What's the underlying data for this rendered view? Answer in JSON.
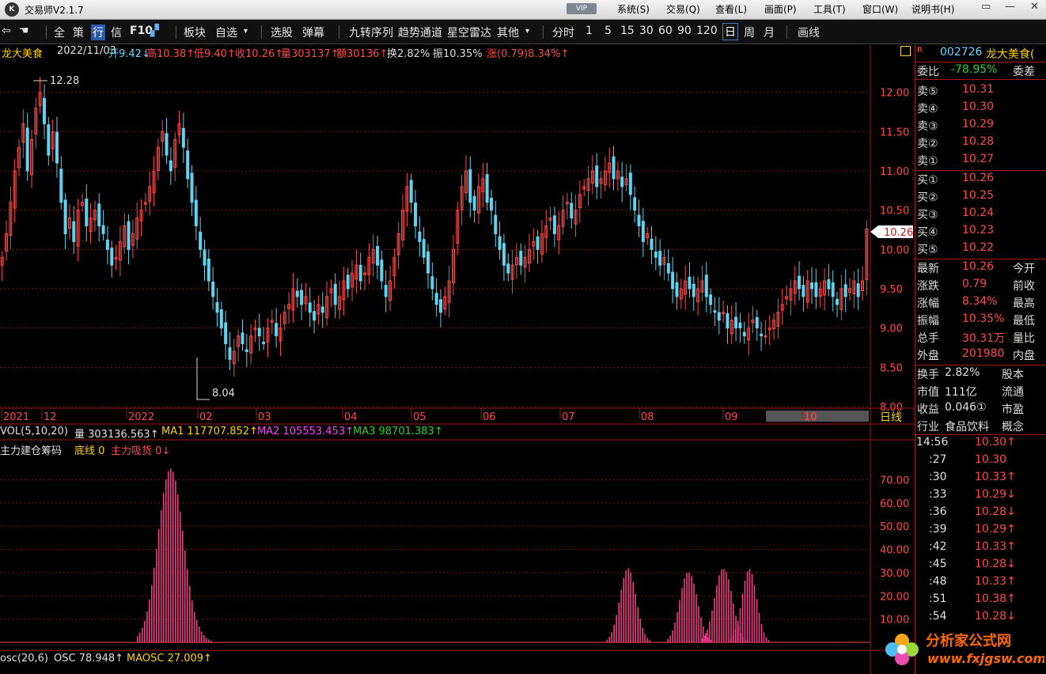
{
  "app": {
    "title": "交易师V2.1.7",
    "logo_text": "K",
    "vip": "VIP"
  },
  "menu": [
    "系统(S)",
    "交易(Q)",
    "查看(L)",
    "画面(P)",
    "工具(T)",
    "窗口(W)",
    "说明书(H)"
  ],
  "window_buttons": [
    "▭",
    "—",
    "✕"
  ],
  "toolbar": {
    "items": [
      "全",
      "策",
      "行",
      "信",
      "F10",
      "板块",
      "自选",
      "选股",
      "弹幕",
      "九转序列",
      "趋势通道",
      "星空雷达",
      "其他",
      "分时",
      "1",
      "5",
      "15",
      "30",
      "60",
      "90",
      "120",
      "日",
      "周",
      "月",
      "画线"
    ],
    "dropdown_arrow": "▾"
  },
  "info_bar": {
    "name": "龙大美食",
    "date": "2022/11/03",
    "open": "开9.42↓",
    "high": "高10.38↑",
    "low": "低9.40↑",
    "close": "收10.26↑",
    "volume": "量303137↑",
    "amount": "额30136↑",
    "turnover": "换2.82%",
    "amplitude": "振10.35%",
    "change": "涨(0.79)8.34%↑"
  },
  "chart_data": [
    {
      "type": "candlestick",
      "title": "龙大美食 日线",
      "price_ticks": [
        "12.00",
        "11.50",
        "11.00",
        "10.50",
        "10.00",
        "9.50",
        "9.00",
        "8.50",
        "8.00"
      ],
      "ylim": [
        8.0,
        12.5
      ],
      "annotations": [
        {
          "label": "12.28",
          "value": 12.28
        },
        {
          "label": "8.04",
          "value": 8.04
        }
      ],
      "last_price_label": "10.26",
      "x_labels": [
        "2021",
        "12",
        "2022",
        "02",
        "03",
        "04",
        "05",
        "06",
        "07",
        "08",
        "09",
        "10"
      ],
      "period_label": "日线",
      "closes": [
        9.9,
        10.2,
        10.6,
        11.0,
        11.3,
        11.6,
        11.0,
        11.4,
        11.8,
        12.0,
        11.6,
        11.2,
        11.5,
        11.1,
        10.6,
        10.2,
        10.4,
        10.1,
        10.5,
        10.6,
        10.3,
        10.4,
        10.5,
        10.3,
        10.2,
        10.0,
        9.8,
        9.9,
        10.1,
        10.3,
        10.0,
        10.2,
        10.4,
        10.5,
        10.6,
        10.8,
        11.0,
        11.3,
        11.5,
        11.2,
        11.0,
        11.4,
        11.6,
        11.3,
        10.9,
        10.6,
        10.3,
        10.0,
        9.8,
        9.6,
        9.4,
        9.2,
        9.0,
        8.8,
        8.6,
        8.7,
        8.9,
        8.8,
        8.7,
        8.9,
        9.0,
        8.9,
        8.8,
        9.0,
        9.1,
        8.9,
        9.0,
        9.2,
        9.3,
        9.5,
        9.4,
        9.3,
        9.4,
        9.2,
        9.1,
        9.3,
        9.2,
        9.4,
        9.5,
        9.3,
        9.4,
        9.6,
        9.5,
        9.7,
        9.8,
        9.6,
        9.7,
        9.9,
        10.0,
        9.8,
        9.6,
        9.4,
        9.6,
        9.9,
        10.2,
        10.5,
        10.8,
        10.6,
        10.3,
        10.1,
        9.9,
        9.7,
        9.5,
        9.3,
        9.2,
        9.4,
        9.6,
        10.0,
        10.5,
        10.8,
        11.0,
        10.6,
        10.5,
        10.8,
        10.9,
        10.6,
        10.5,
        10.2,
        10.0,
        9.8,
        9.7,
        9.8,
        9.9,
        9.8,
        9.9,
        10.0,
        10.1,
        10.0,
        10.2,
        10.3,
        10.4,
        10.2,
        10.3,
        10.5,
        10.6,
        10.4,
        10.5,
        10.7,
        10.8,
        10.9,
        11.0,
        10.8,
        10.9,
        11.0,
        11.1,
        10.9,
        11.0,
        10.8,
        10.9,
        10.7,
        10.5,
        10.3,
        10.1,
        10.2,
        10.0,
        9.9,
        9.8,
        9.9,
        9.7,
        9.5,
        9.4,
        9.5,
        9.6,
        9.5,
        9.4,
        9.5,
        9.6,
        9.4,
        9.3,
        9.2,
        9.1,
        9.2,
        9.0,
        9.1,
        9.0,
        9.0,
        8.9,
        9.0,
        9.1,
        9.0,
        8.9,
        8.9,
        9.0,
        9.1,
        9.2,
        9.3,
        9.4,
        9.5,
        9.6,
        9.5,
        9.4,
        9.6,
        9.5,
        9.4,
        9.5,
        9.6,
        9.5,
        9.4,
        9.3,
        9.5,
        9.4,
        9.5,
        9.6,
        9.4,
        9.6,
        10.26
      ]
    },
    {
      "type": "bar",
      "title": "主力建仓筹码",
      "y_ticks": [
        "70.00",
        "60.00",
        "50.00",
        "40.00",
        "30.00",
        "20.00",
        "10.00"
      ],
      "ylim": [
        0,
        80
      ],
      "clusters": [
        {
          "center": 0.196,
          "peak": 75,
          "width": 0.032
        },
        {
          "center": 0.722,
          "peak": 32,
          "width": 0.02
        },
        {
          "center": 0.792,
          "peak": 35,
          "width": 0.02
        },
        {
          "center": 0.832,
          "peak": 37,
          "width": 0.02
        },
        {
          "center": 0.862,
          "peak": 32,
          "width": 0.018
        }
      ]
    }
  ],
  "vol_bar": {
    "label": "VOL(5,10,20)",
    "vol": "量 303136.563↑",
    "ma1": "MA1 117707.852↑",
    "ma2": "MA2 105553.453↑",
    "ma3": "MA3 98701.383↑"
  },
  "indicator_bar": {
    "name": "主力建仓筹码",
    "bottom": "底线 0",
    "main": "主力吸货 0↓"
  },
  "osc_bar": {
    "label": "osc(20,6)",
    "osc": "OSC 78.948↑",
    "maosc": "MAOSC 27.009↑"
  },
  "panel": {
    "r_mark": "R",
    "code": "002726",
    "name": "龙大美食(",
    "ratio_label": "委比",
    "ratio": "-78.95%",
    "diff_label": "委差",
    "sell": [
      {
        "label": "卖⑤",
        "price": "10.31"
      },
      {
        "label": "卖④",
        "price": "10.30"
      },
      {
        "label": "卖③",
        "price": "10.29"
      },
      {
        "label": "卖②",
        "price": "10.28"
      },
      {
        "label": "卖①",
        "price": "10.27"
      }
    ],
    "buy": [
      {
        "label": "买①",
        "price": "10.26"
      },
      {
        "label": "买②",
        "price": "10.25"
      },
      {
        "label": "买③",
        "price": "10.24"
      },
      {
        "label": "买④",
        "price": "10.23"
      },
      {
        "label": "买⑤",
        "price": "10.22"
      }
    ],
    "quote": [
      {
        "l": "最新",
        "v": "10.26",
        "r": "今开"
      },
      {
        "l": "涨跌",
        "v": "0.79",
        "r": "前收"
      },
      {
        "l": "涨幅",
        "v": "8.34%",
        "r": "最高"
      },
      {
        "l": "振幅",
        "v": "10.35%",
        "r": "最低"
      },
      {
        "l": "总手",
        "v": "30.31万",
        "r": "量比"
      },
      {
        "l": "外盘",
        "v": "201980",
        "r": "内盘"
      }
    ],
    "stats": [
      {
        "l": "换手",
        "v": "2.82%",
        "r": "股本"
      },
      {
        "l": "市值",
        "v": "111亿",
        "r": "流通"
      },
      {
        "l": "收益",
        "v": "0.046①",
        "r": "市盈"
      },
      {
        "l": "行业",
        "v": "食品饮料",
        "r": "概念"
      }
    ],
    "ticks": [
      {
        "t": "14:56",
        "p": "10.30↑"
      },
      {
        "t": ":27",
        "p": "10.30"
      },
      {
        "t": ":30",
        "p": "10.33↑"
      },
      {
        "t": ":33",
        "p": "10.29↓"
      },
      {
        "t": ":36",
        "p": "10.28↓"
      },
      {
        "t": ":39",
        "p": "10.29↑"
      },
      {
        "t": ":42",
        "p": "10.33↑"
      },
      {
        "t": ":45",
        "p": "10.28↓"
      },
      {
        "t": ":48",
        "p": "10.33↑"
      },
      {
        "t": ":51",
        "p": "10.38↑"
      },
      {
        "t": ":54",
        "p": "10.28↓"
      }
    ]
  },
  "watermark": {
    "text": "分析家公式网",
    "url": "www.fxjgsw.com"
  },
  "colors": {
    "up": "#ff4a4a",
    "down": "#5fd3f0",
    "grid": "#7a1212",
    "bar": "#ff3d8c"
  }
}
